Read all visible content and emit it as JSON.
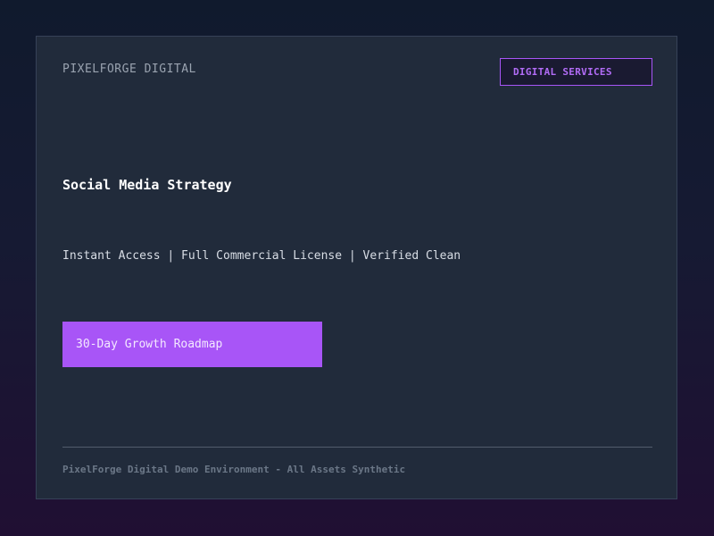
{
  "brand": {
    "name": "PIXELFORGE DIGITAL"
  },
  "badge": {
    "label": "DIGITAL SERVICES"
  },
  "hero": {
    "title": "Social Media Strategy",
    "features": "Instant Access | Full Commercial License | Verified Clean",
    "cta_label": "30-Day Growth Roadmap"
  },
  "footer": {
    "text": "PixelForge Digital Demo Environment - All Assets Synthetic"
  },
  "colors": {
    "accent": "#a855f7",
    "card_bg": "#212b3b",
    "page_bg_top": "#101a2d",
    "page_bg_bottom": "#200f33"
  }
}
